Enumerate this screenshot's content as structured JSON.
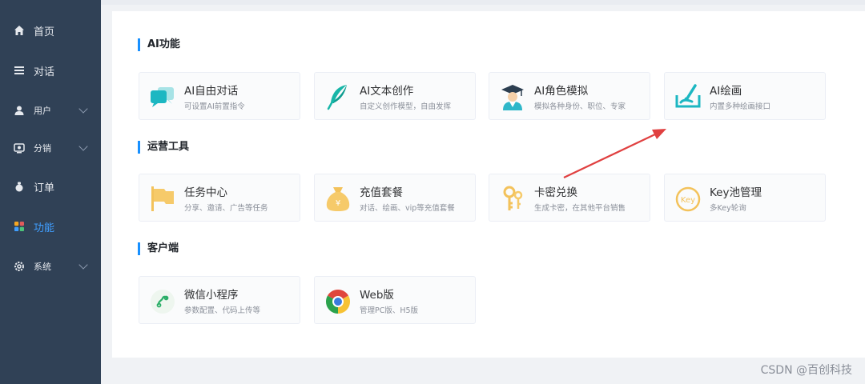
{
  "sidebar": {
    "items": [
      {
        "label": "首页",
        "icon": "home-icon"
      },
      {
        "label": "对话",
        "icon": "list-icon"
      },
      {
        "label": "用户",
        "icon": "user-icon"
      },
      {
        "label": "分销",
        "icon": "distribution-icon"
      },
      {
        "label": "订单",
        "icon": "order-icon"
      },
      {
        "label": "功能",
        "icon": "apps-icon",
        "active": true
      },
      {
        "label": "系统",
        "icon": "settings-icon"
      }
    ]
  },
  "sections": [
    {
      "title": "AI功能",
      "tiles": [
        {
          "name": "AI自由对话",
          "desc": "可设置AI前置指令",
          "icon": "chat-bubbles-icon"
        },
        {
          "name": "AI文本创作",
          "desc": "自定义创作模型，自由发挥",
          "icon": "feather-icon"
        },
        {
          "name": "AI角色模拟",
          "desc": "模拟各种身份、职位、专家",
          "icon": "graduate-icon"
        },
        {
          "name": "AI绘画",
          "desc": "内置多种绘画接口",
          "icon": "paint-brush-icon"
        }
      ]
    },
    {
      "title": "运营工具",
      "tiles": [
        {
          "name": "任务中心",
          "desc": "分享、邀请、广告等任务",
          "icon": "flag-icon"
        },
        {
          "name": "充值套餐",
          "desc": "对话、绘画、vip等充值套餐",
          "icon": "money-bag-icon"
        },
        {
          "name": "卡密兑换",
          "desc": "生成卡密，在其他平台销售",
          "icon": "keys-icon"
        },
        {
          "name": "Key池管理",
          "desc": "多Key轮询",
          "icon": "key-circle-icon"
        }
      ]
    },
    {
      "title": "客户端",
      "tiles": [
        {
          "name": "微信小程序",
          "desc": "参数配置、代码上传等",
          "icon": "mini-program-icon"
        },
        {
          "name": "Web版",
          "desc": "管理PC版、H5版",
          "icon": "chrome-icon"
        }
      ]
    }
  ],
  "colors": {
    "sidebar_bg": "#304156",
    "accent": "#409eff",
    "section_bar": "#1890ff",
    "arrow": "#e04040"
  },
  "watermark": "CSDN @百创科技"
}
